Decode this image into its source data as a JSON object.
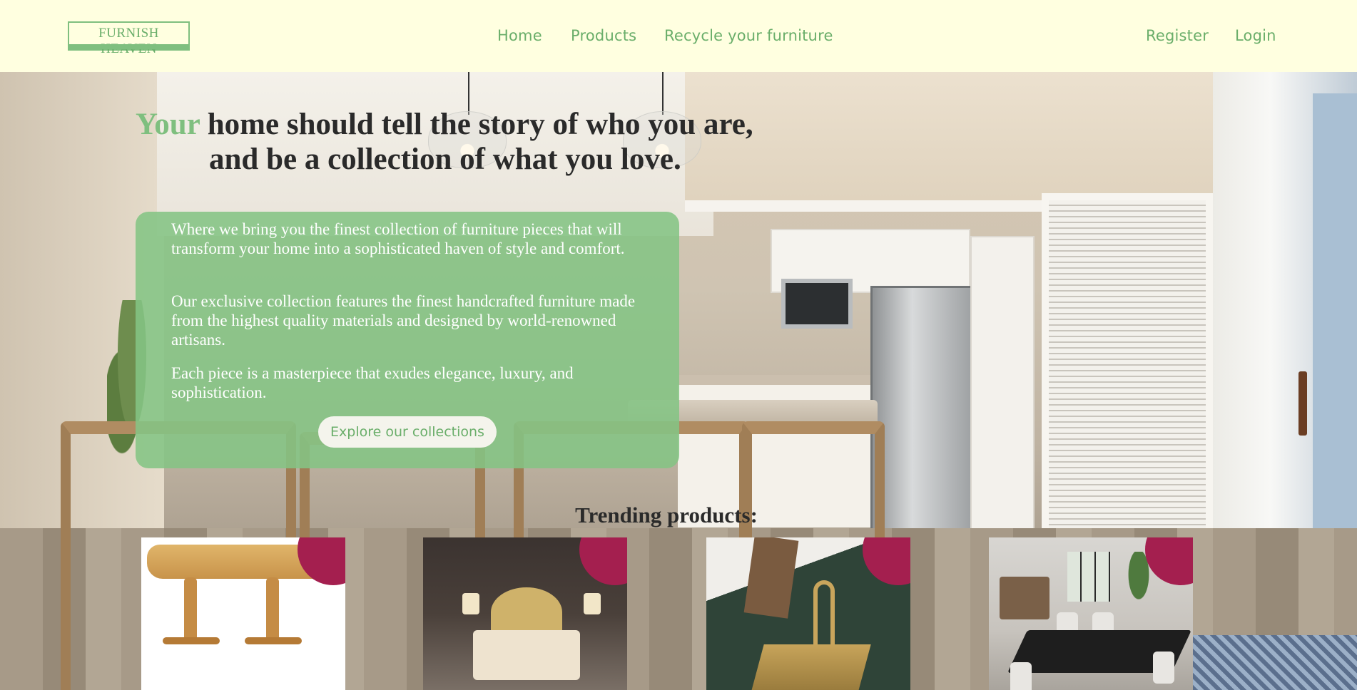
{
  "brand": {
    "logo_text": "FURNISH HEAVEN"
  },
  "nav": {
    "home": "Home",
    "products": "Products",
    "recycle": "Recycle your furniture"
  },
  "auth": {
    "register": "Register",
    "login": "Login"
  },
  "hero": {
    "headline_accent": "Your",
    "headline_rest_line1": " home should tell the story of who you are,",
    "headline_line2": "and be a collection of what you love.",
    "paragraph1": "Where we bring you the finest collection of furniture pieces that will transform your home into a sophisticated haven of style and comfort.",
    "paragraph2": "Our exclusive collection features the finest handcrafted furniture made from the highest quality materials and designed by world-renowned artisans.",
    "paragraph3": "Each piece is a masterpiece that exudes elegance, luxury, and sophistication.",
    "cta": "Explore our collections"
  },
  "trending": {
    "title": "Trending products:",
    "badge_icon": "trending-up-icon",
    "products": [
      {
        "image": "wooden extension dining table"
      },
      {
        "image": "tufted gold bed in bedroom"
      },
      {
        "image": "gold kitchen sink with tap"
      },
      {
        "image": "black dining table with chairs"
      }
    ]
  },
  "colors": {
    "header_bg": "#ffffe0",
    "accent_green": "#7fbf7f",
    "panel_green": "#84c484",
    "badge": "#a41f4f"
  }
}
